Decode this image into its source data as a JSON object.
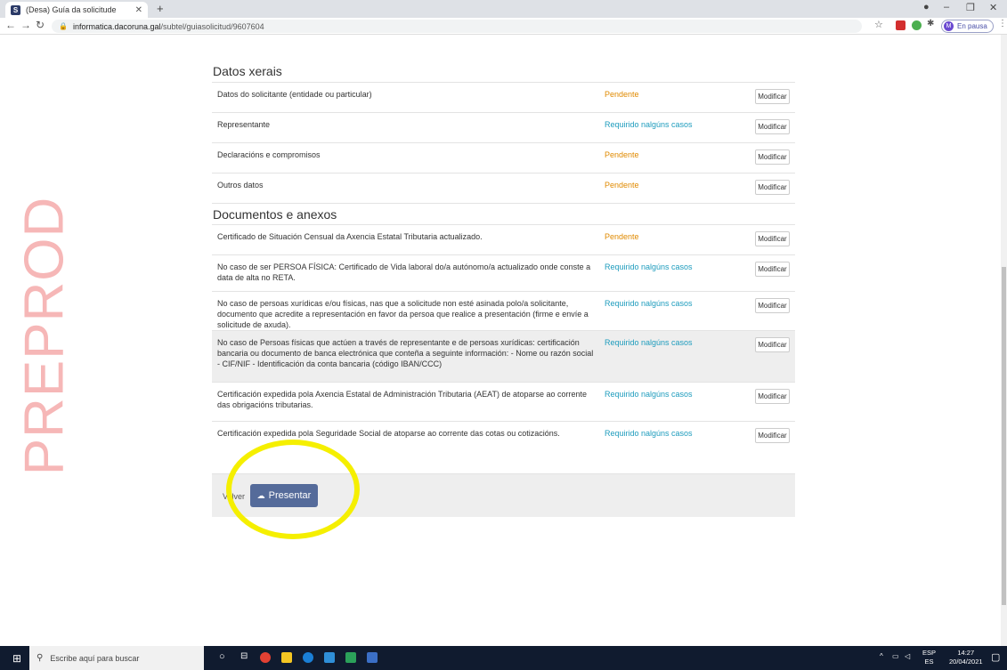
{
  "browser": {
    "tab_title": "(Desa) Guía da solicitude",
    "tab_favicon": "S",
    "url_host": "informatica.dacoruna.gal",
    "url_path": "/subtel/guiasolicitud/9607604",
    "profile_initial": "M",
    "profile_label": "En pausa"
  },
  "watermark": "PREPROD",
  "sections": {
    "datos_xerais": {
      "title": "Datos xerais",
      "rows": [
        {
          "label": "Datos do solicitante (entidade ou particular)",
          "status": "Pendente",
          "button": "Modificar"
        },
        {
          "label": "Representante",
          "status": "Requirido nalgúns casos",
          "button": "Modificar"
        },
        {
          "label": "Declaracións e compromisos",
          "status": "Pendente",
          "button": "Modificar"
        },
        {
          "label": "Outros datos",
          "status": "Pendente",
          "button": "Modificar"
        }
      ]
    },
    "documentos": {
      "title": "Documentos e anexos",
      "rows": [
        {
          "label": "Certificado de Situación Censual da Axencia Estatal Tributaria actualizado.",
          "status": "Pendente",
          "button": "Modificar"
        },
        {
          "label": "No caso de ser PERSOA FÍSICA: Certificado de Vida laboral do/a autónomo/a actualizado onde conste a data de alta no RETA.",
          "status": "Requirido nalgúns casos",
          "button": "Modificar"
        },
        {
          "label": "No caso de persoas xurídicas e/ou físicas, nas que a solicitude non esté asinada polo/a solicitante, documento que acredite a representación en favor da persoa que realice a presentación (firme e envíe a solicitude de axuda).",
          "status": "Requirido nalgúns casos",
          "button": "Modificar"
        },
        {
          "label": "No caso de Persoas físicas que actúen a través de representante e de persoas xurídicas: certificación bancaria ou documento de banca electrónica que conteña a seguinte información: - Nome ou razón social - CIF/NIF - Identificación da conta bancaria (código IBAN/CCC)",
          "status": "Requirido nalgúns casos",
          "button": "Modificar"
        },
        {
          "label": "Certificación expedida pola Axencia Estatal de Administración Tributaria (AEAT) de atoparse ao corrente das obrigacións tributarias.",
          "status": "Requirido nalgúns casos",
          "button": "Modificar"
        },
        {
          "label": "Certificación expedida pola Seguridade Social de atoparse ao corrente das cotas ou cotizacións.",
          "status": "Requirido nalgúns casos",
          "button": "Modificar"
        }
      ]
    }
  },
  "footer": {
    "volver": "Volver",
    "presentar": "Presentar"
  },
  "taskbar": {
    "search_placeholder": "Escribe aquí para buscar",
    "lang_top": "ESP",
    "lang_bottom": "ES",
    "time": "14:27",
    "date": "20/04/2021"
  },
  "colors": {
    "pending": "#e08a00",
    "required": "#1e9cbd",
    "presentar": "#556b9a",
    "highlight": "#f5ef00"
  }
}
